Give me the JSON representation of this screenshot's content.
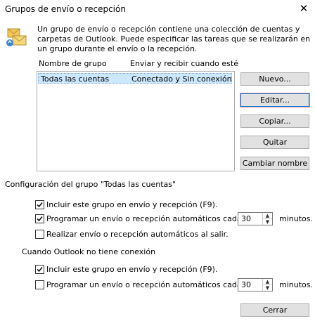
{
  "window": {
    "title": "Grupos de envío o recepción",
    "close_glyph": "✕"
  },
  "description": "Un grupo de envío o recepción contiene una colección de cuentas y carpetas de Outlook. Puede especificar las tareas que se realizarán en un grupo durante el envío o la recepción.",
  "list": {
    "headers": [
      "Nombre de grupo",
      "Enviar y recibir cuando esté"
    ],
    "rows": [
      {
        "name": "Todas las cuentas",
        "mode": "Conectado y Sin conexión"
      }
    ]
  },
  "buttons": {
    "new": "Nuevo...",
    "edit": "Editar...",
    "copy": "Copiar...",
    "remove": "Quitar",
    "rename": "Cambiar nombre",
    "close": "Cerrar"
  },
  "online": {
    "heading": "Configuración del grupo \"Todas las cuentas\"",
    "include_label": "Incluir este grupo en envío y recepción (F9).",
    "include_checked": true,
    "schedule_label": "Programar un envío o recepción automáticos cada",
    "schedule_checked": true,
    "minutes_value": "30",
    "minutes_unit": "minutos.",
    "on_exit_label": "Realizar envío o recepción automáticos al salir.",
    "on_exit_checked": false
  },
  "offline": {
    "heading": "Cuando Outlook no tiene conexión",
    "include_label": "Incluir este grupo en envío y recepción (F9).",
    "include_checked": true,
    "schedule_label": "Programar un envío o recepción automáticos cada",
    "schedule_checked": false,
    "minutes_value": "30",
    "minutes_unit": "minutos."
  },
  "icons": {
    "group": "send-receive-group-icon",
    "checkbox": "checkmark-icon",
    "spin_up": "spin-up-icon",
    "spin_down": "spin-down-icon"
  }
}
